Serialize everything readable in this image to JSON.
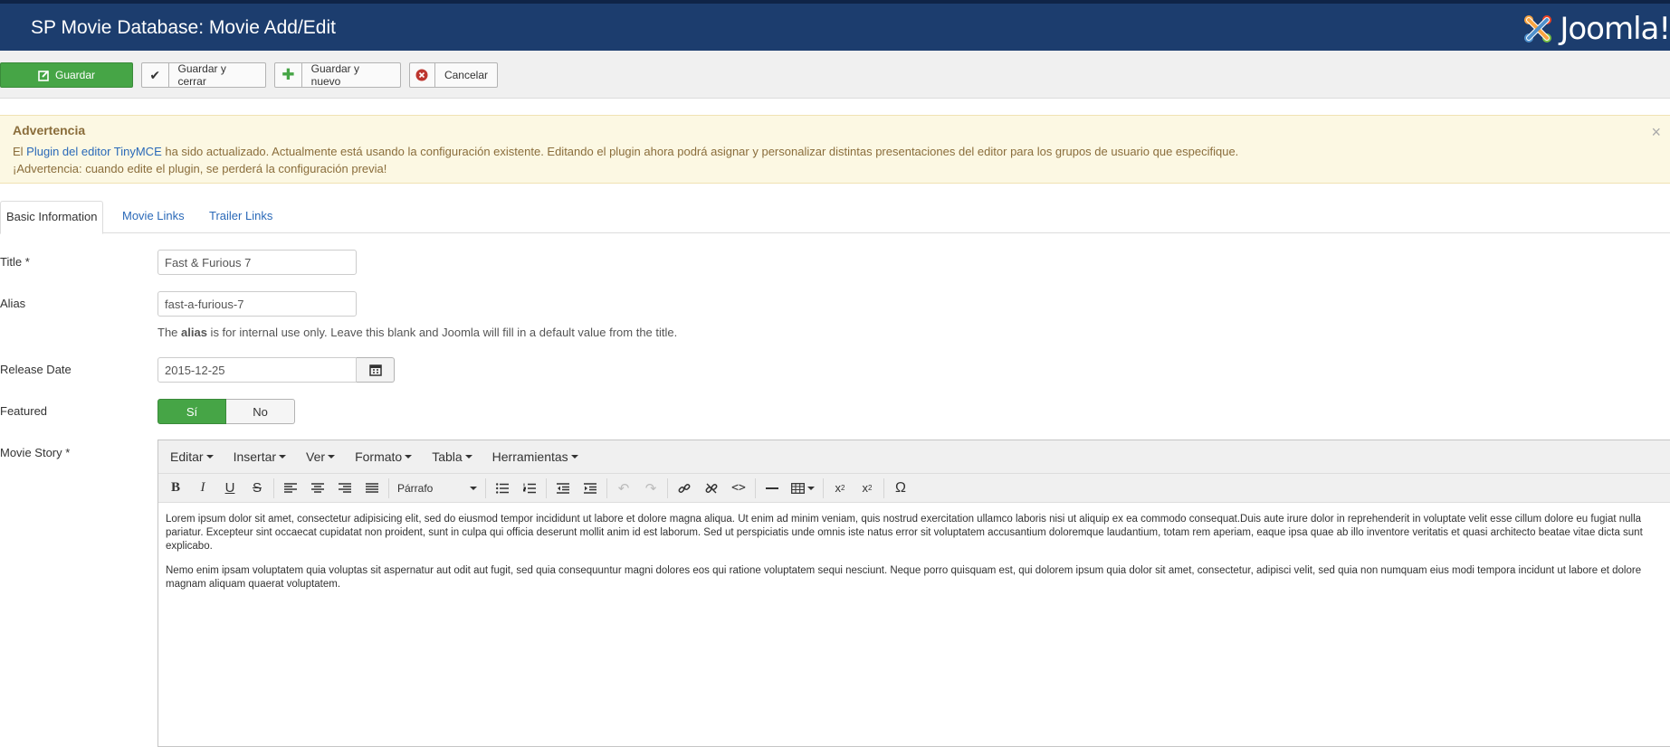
{
  "header": {
    "title": "SP Movie Database: Movie Add/Edit",
    "logo_text": "Joomla!"
  },
  "toolbar": {
    "save": "Guardar",
    "save_close": "Guardar y cerrar",
    "save_new": "Guardar y nuevo",
    "cancel": "Cancelar"
  },
  "alert": {
    "heading": "Advertencia",
    "line1_pre": "El ",
    "line1_link": "Plugin del editor TinyMCE",
    "line1_post": " ha sido actualizado. Actualmente está usando la configuración existente. Editando el plugin ahora podrá asignar y personalizar distintas presentaciones del editor para los grupos de usuario que especifique.",
    "line2": "¡Advertencia: cuando edite el plugin, se perderá la configuración previa!",
    "close": "×"
  },
  "tabs": [
    {
      "label": "Basic Information"
    },
    {
      "label": "Movie Links"
    },
    {
      "label": "Trailer Links"
    }
  ],
  "form": {
    "title_label": "Title *",
    "title_value": "Fast & Furious 7",
    "alias_label": "Alias",
    "alias_value": "fast-a-furious-7",
    "alias_help_pre": "The ",
    "alias_help_bold": "alias",
    "alias_help_post": " is for internal use only. Leave this blank and Joomla will fill in a default value from the title.",
    "release_label": "Release Date",
    "release_value": "2015-12-25",
    "featured_label": "Featured",
    "featured_yes": "Sí",
    "featured_no": "No",
    "story_label": "Movie Story *"
  },
  "editor": {
    "menus": [
      "Editar",
      "Insertar",
      "Ver",
      "Formato",
      "Tabla",
      "Herramientas"
    ],
    "format_select": "Párrafo",
    "paragraphs": [
      "Lorem ipsum dolor sit amet, consectetur adipisicing elit, sed do eiusmod tempor incididunt ut labore et dolore magna aliqua. Ut enim ad minim veniam, quis nostrud exercitation ullamco laboris nisi ut aliquip ex ea commodo consequat.Duis aute irure dolor in reprehenderit in voluptate velit esse cillum dolore eu fugiat nulla pariatur. Excepteur sint occaecat cupidatat non proident, sunt in culpa qui officia deserunt mollit anim id est laborum. Sed ut perspiciatis unde omnis iste natus error sit voluptatem accusantium doloremque laudantium, totam rem aperiam, eaque ipsa quae ab illo inventore veritatis et quasi architecto beatae vitae dicta sunt explicabo.",
      "Nemo enim ipsam voluptatem quia voluptas sit aspernatur aut odit aut fugit, sed quia consequuntur magni dolores eos qui ratione voluptatem sequi nesciunt. Neque porro quisquam est, qui dolorem ipsum quia dolor sit amet, consectetur, adipisci velit, sed quia non numquam eius modi tempora incidunt ut labore et dolore magnam aliquam quaerat voluptatem."
    ]
  },
  "colors": {
    "header_bg": "#1c3d6e",
    "success": "#46a546",
    "alert_bg": "#fcf8e3",
    "link": "#2a69b8"
  }
}
